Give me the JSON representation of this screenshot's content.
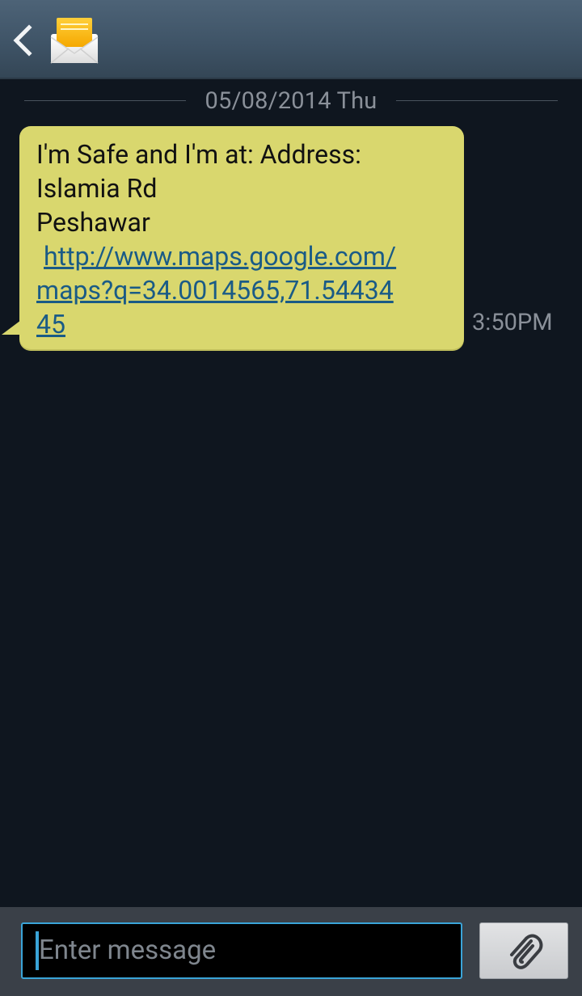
{
  "header": {
    "back_icon": "chevron-left-icon",
    "contact_icon": "envelope-icon",
    "contact_name": ""
  },
  "conversation": {
    "date_separator": "05/08/2014 Thu",
    "message": {
      "line1": "I'm Safe and I'm at: Address:",
      "line2": "Islamia Rd",
      "line3": "Peshawar",
      "link_line1": "http://www.maps.google.com/",
      "link_line2": "maps?q=34.0014565,71.54434",
      "link_line3": "45",
      "time": "3:50PM"
    }
  },
  "composer": {
    "placeholder": "Enter message",
    "attach_icon": "paperclip-icon"
  },
  "colors": {
    "header_bg": "#3f5467",
    "background": "#0f161f",
    "bubble": "#d9d76e",
    "link": "#1a5b86",
    "accent": "#3aa4d8",
    "muted_text": "#8a9099"
  }
}
